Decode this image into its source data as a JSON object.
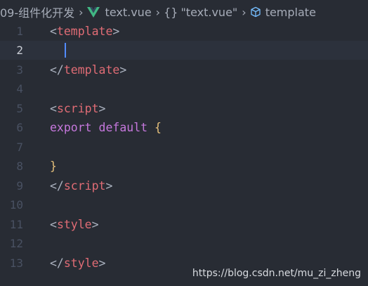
{
  "breadcrumb": {
    "folder": "09-组件化开发",
    "file": "text.vue",
    "object": "\"text.vue\"",
    "symbol": "template"
  },
  "editor": {
    "line_numbers": [
      "1",
      "2",
      "3",
      "4",
      "5",
      "6",
      "7",
      "8",
      "9",
      "10",
      "11",
      "12",
      "13"
    ],
    "active_line": 2,
    "lines": {
      "l1": {
        "open": "<",
        "tag": "template",
        "close": ">"
      },
      "l3": {
        "open": "</",
        "tag": "template",
        "close": ">"
      },
      "l5": {
        "open": "<",
        "tag": "script",
        "close": ">"
      },
      "l6": {
        "kw1": "export",
        "kw2": "default",
        "brace": "{"
      },
      "l8": {
        "brace": "}"
      },
      "l9": {
        "open": "</",
        "tag": "script",
        "close": ">"
      },
      "l11": {
        "open": "<",
        "tag": "style",
        "close": ">"
      },
      "l13": {
        "open": "</",
        "tag": "style",
        "close": ">"
      }
    }
  },
  "watermark": "https://blog.csdn.net/mu_zi_zheng",
  "colors": {
    "background": "#282c34",
    "active_line": "#2c313c",
    "tag": "#e06c75",
    "keyword": "#c678dd",
    "brace": "#e5c07b",
    "line_number": "#495162",
    "cursor": "#528bff",
    "vue_green": "#41b883"
  },
  "icons": [
    "chevron-right-icon",
    "vue-file-icon",
    "braces-icon",
    "cube-icon"
  ]
}
